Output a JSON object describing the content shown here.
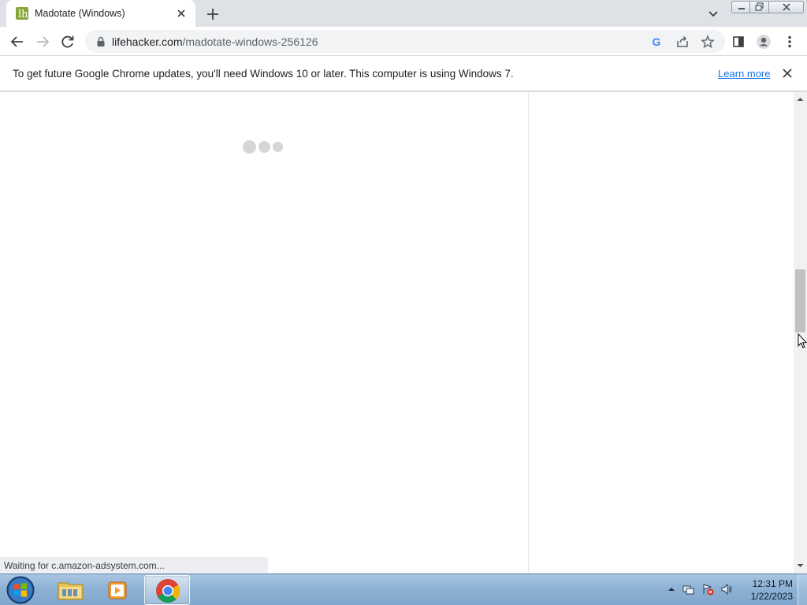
{
  "browser": {
    "tab": {
      "title": "Madotate (Windows)",
      "favicon": "lifehacker-icon"
    },
    "url": {
      "host": "lifehacker.com",
      "path": "/madotate-windows-256126"
    },
    "infobar": {
      "message": "To get future Google Chrome updates, you'll need Windows 10 or later. This computer is using Windows 7.",
      "learn_more": "Learn more"
    },
    "status": "Waiting for c.amazon-adsystem.com..."
  },
  "taskbar": {
    "time": "12:31 PM",
    "date": "1/22/2023",
    "apps": [
      "windows-explorer",
      "media-player",
      "chrome"
    ]
  },
  "colors": {
    "accent": "#1a73e8",
    "tabstrip": "#dee1e6",
    "favicon": "#8aa63a",
    "taskbar": "#8eb2d5"
  }
}
